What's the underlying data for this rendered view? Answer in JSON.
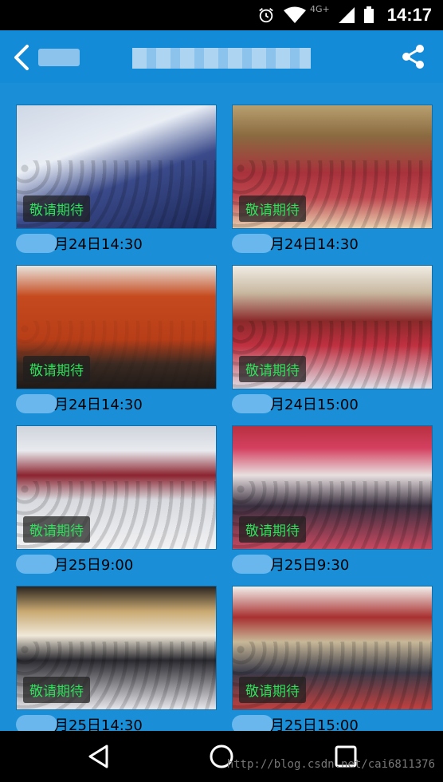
{
  "status_bar": {
    "time": "14:17",
    "network": "4G+",
    "icons": [
      "alarm-icon",
      "wifi-icon",
      "signal-icon",
      "battery-icon"
    ]
  },
  "app_bar": {
    "back_icon": "chevron-left-icon",
    "back_label": "",
    "title": "",
    "share_icon": "share-icon"
  },
  "cards": [
    {
      "badge": "敬请期待",
      "date": "月24日14:30"
    },
    {
      "badge": "敬请期待",
      "date": "月24日14:30"
    },
    {
      "badge": "敬请期待",
      "date": "月24日14:30"
    },
    {
      "badge": "敬请期待",
      "date": "月24日15:00"
    },
    {
      "badge": "敬请期待",
      "date": "月25日9:00"
    },
    {
      "badge": "敬请期待",
      "date": "月25日9:30"
    },
    {
      "badge": "敬请期待",
      "date": "月25日14:30"
    },
    {
      "badge": "敬请期待",
      "date": "月25日15:00"
    }
  ],
  "nav_bar": {
    "icons": [
      "back-triangle-icon",
      "home-circle-icon",
      "recents-square-icon"
    ],
    "watermark": "http://blog.csdn.net/cai6811376"
  },
  "colors": {
    "background": "#1a8fd8",
    "app_bar": "#148bd6",
    "badge_text": "#2ee05a"
  }
}
